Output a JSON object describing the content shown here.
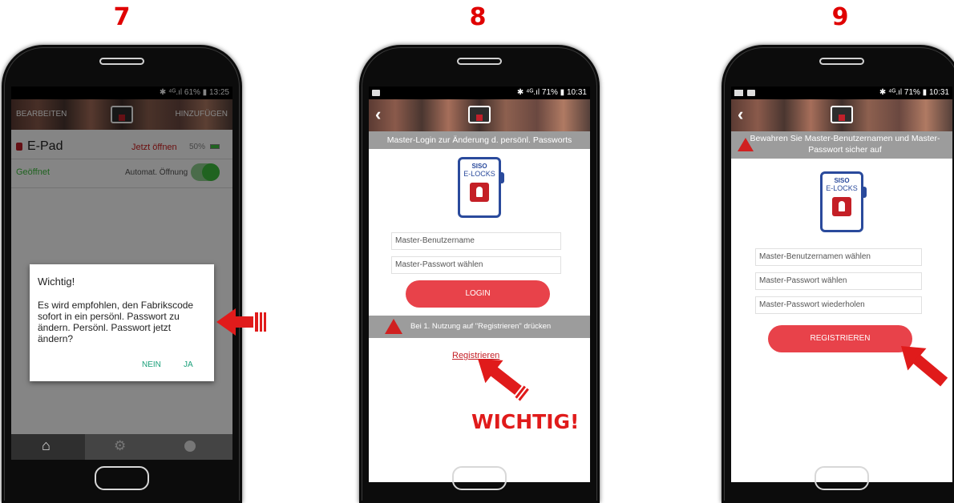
{
  "steps": [
    "7",
    "8",
    "9"
  ],
  "phone1": {
    "status": "✱ ⁴ᴳ.ıl 61% ▮ 13:25",
    "edit": "BEARBEITEN",
    "add": "HINZUFÜGEN",
    "device_name": "E-Pad",
    "open_now": "Jetzt öffnen",
    "battery": "50%",
    "state": "Geöffnet",
    "auto_open": "Automat. Öffnung",
    "dialog": {
      "title": "Wichtig!",
      "message": "Es wird empfohlen, den Fabrikscode sofort in ein persönl. Passwort zu ändern. Persönl. Passwort jetzt ändern?",
      "no": "NEIN",
      "yes": "JA"
    }
  },
  "phone2": {
    "status": "✱ ⁴ᴳ.ıl 71% ▮ 10:31",
    "banner": "Master-Login zur Änderung d. persönl. Passworts",
    "logo_line1": "SISO",
    "logo_line2": "E-LOCKS",
    "username_placeholder": "Master-Benutzername",
    "password_placeholder": "Master-Passwort wählen",
    "login": "LOGIN",
    "notice": "Bei 1. Nutzung auf \"Registrieren\" drücken",
    "register_link": "Registrieren",
    "callout": "WICHTIG!"
  },
  "phone3": {
    "status": "✱ ⁴ᴳ.ıl 71% ▮ 10:31",
    "banner": "Bewahren Sie Master-Benutzernamen und Master-Passwort sicher auf",
    "logo_line1": "SISO",
    "logo_line2": "E-LOCKS",
    "username_placeholder": "Master-Benutzernamen wählen",
    "password_placeholder": "Master-Passwort wählen",
    "password_repeat_placeholder": "Master-Passwort wiederholen",
    "register": "REGISTRIEREN"
  },
  "colors": {
    "accent_red": "#e8424a",
    "toggle_green": "#3fbf3f",
    "annotation_red": "#e01b1b"
  }
}
